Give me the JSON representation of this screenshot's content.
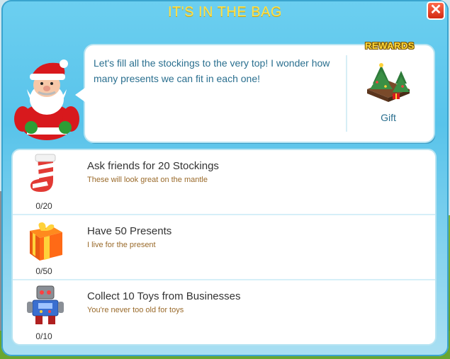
{
  "dialog": {
    "title": "IT'S IN THE BAG",
    "close_label": "✕"
  },
  "speech": {
    "text": "Let's fill all the stockings to the very top! I wonder how many presents we can fit in each one!"
  },
  "rewards": {
    "badge_label": "REWARDS",
    "item_label": "Gift",
    "item_icon": "christmas-tree-gift-icon"
  },
  "tasks": [
    {
      "icon": "stocking-icon",
      "title": "Ask friends for 20 Stockings",
      "subtitle": "These will look great on the mantle",
      "progress": "0/20"
    },
    {
      "icon": "present-icon",
      "title": "Have 50 Presents",
      "subtitle": "I live for the present",
      "progress": "0/50"
    },
    {
      "icon": "toy-robot-icon",
      "title": "Collect 10 Toys from Businesses",
      "subtitle": "You're never too old for toys",
      "progress": "0/10"
    }
  ],
  "colors": {
    "title": "#ffe04a",
    "speech_text": "#2a6f8f",
    "subtitle": "#9a6a2a",
    "close_button": "#e13a1c"
  }
}
